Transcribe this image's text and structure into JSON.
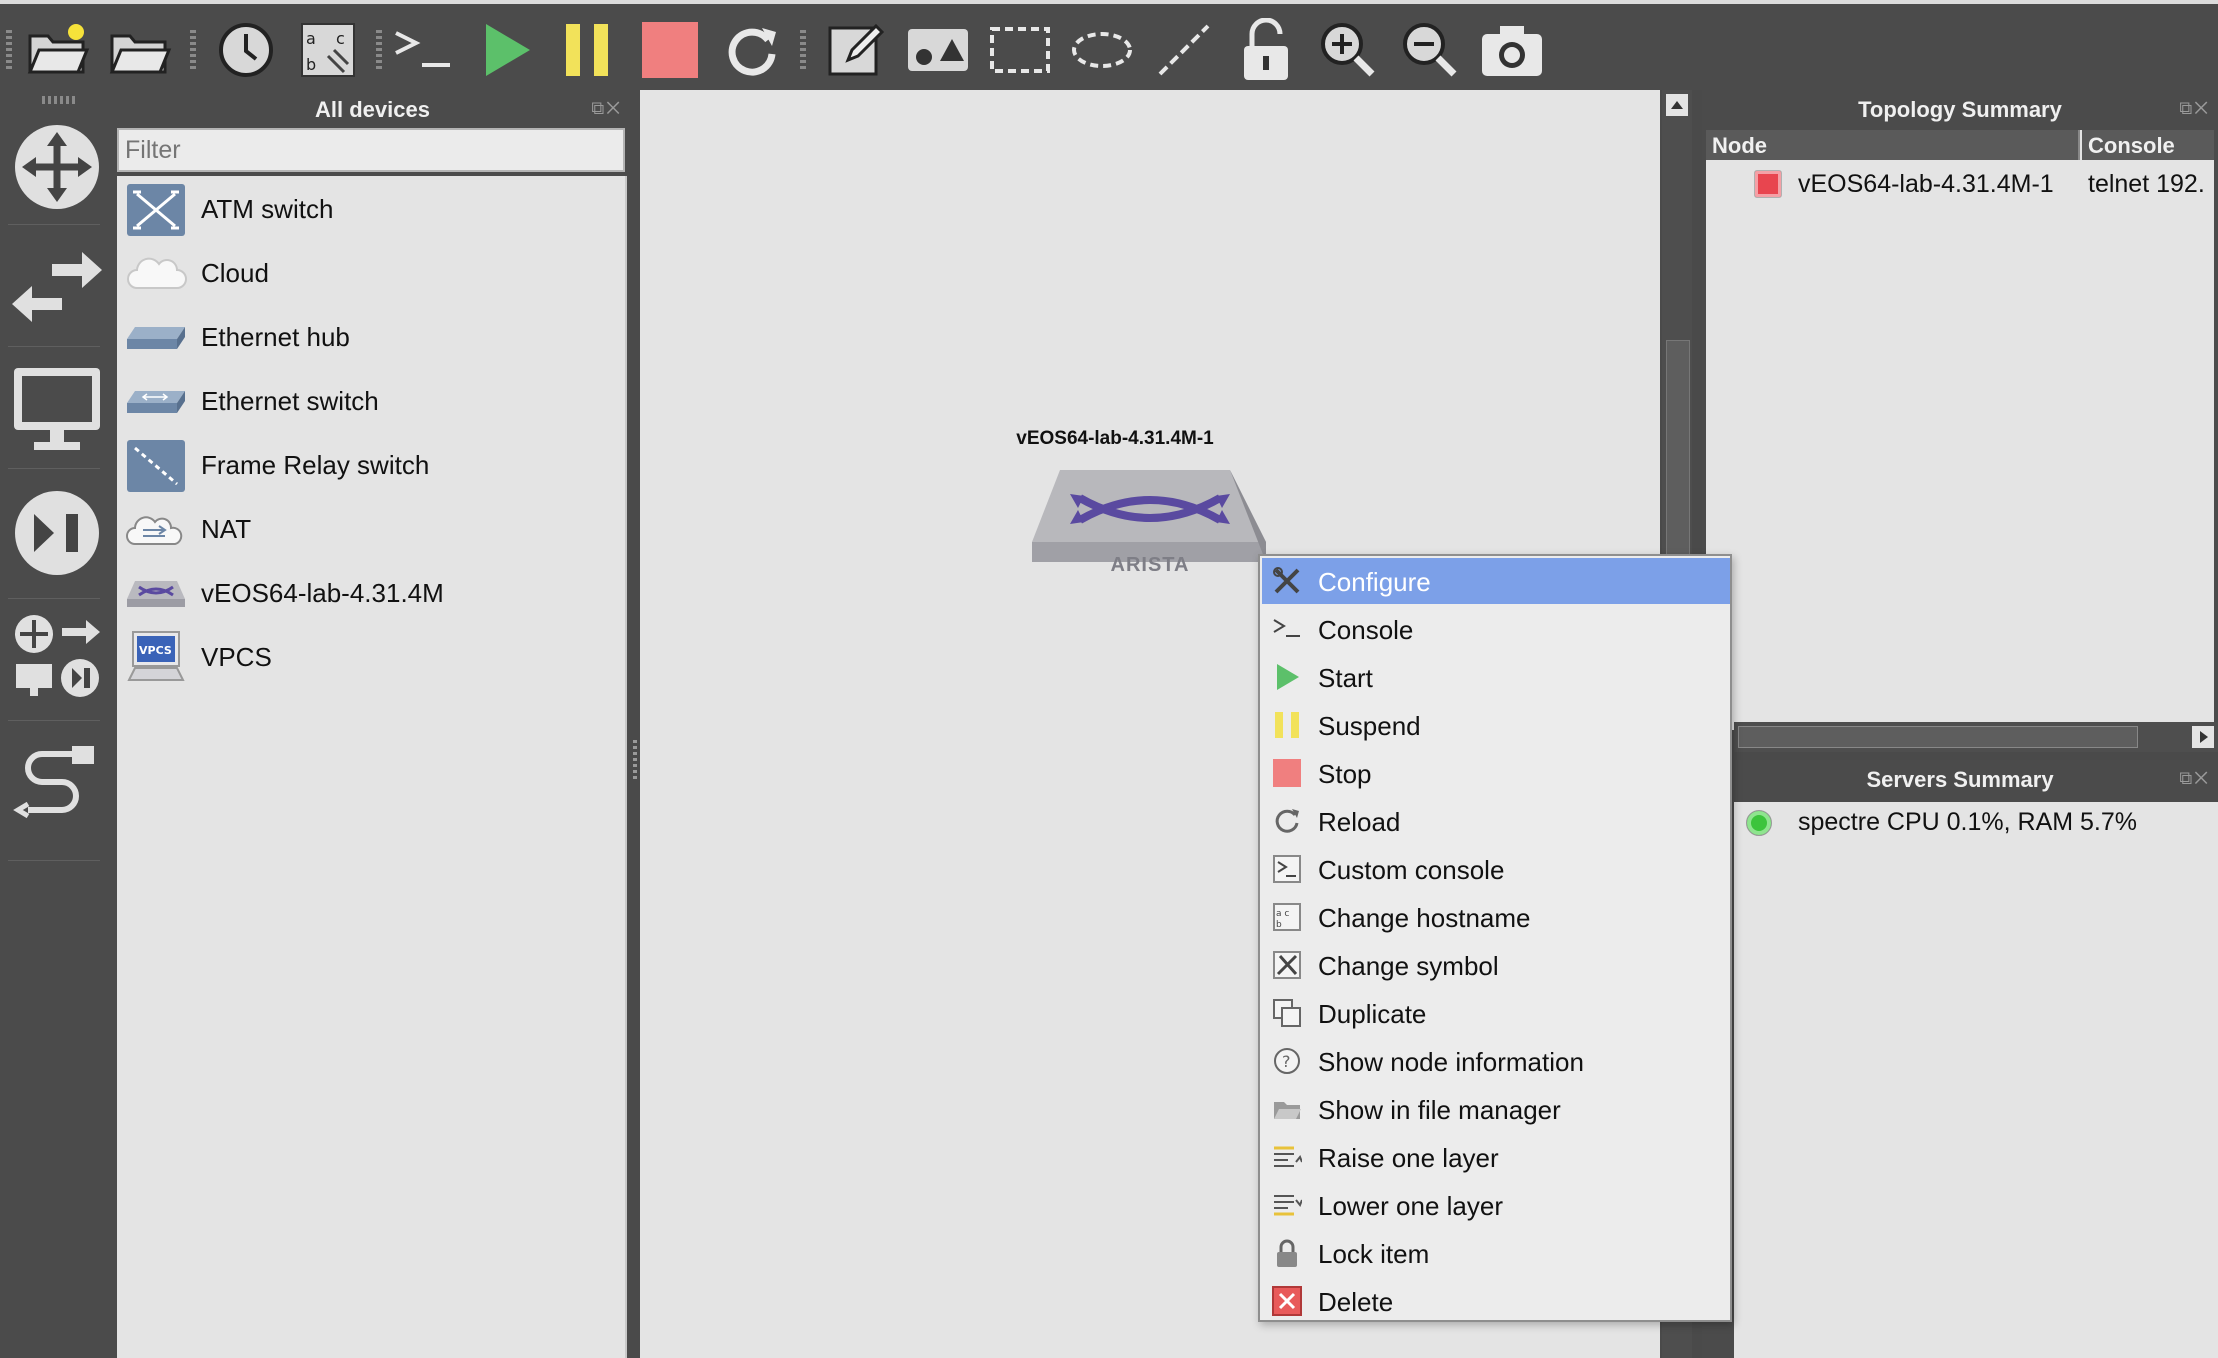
{
  "toolbar": {
    "buttons": [
      "new-project",
      "open-project",
      "snapshot",
      "show-interface-labels",
      "console-all",
      "start-all",
      "suspend-all",
      "stop-all",
      "reload-all",
      "add-note",
      "insert-picture",
      "draw-rectangle",
      "draw-ellipse",
      "draw-line",
      "lock-unlock",
      "zoom-in",
      "zoom-out",
      "screenshot"
    ]
  },
  "devices_panel": {
    "title": "All devices",
    "filter_placeholder": "Filter",
    "items": [
      {
        "label": "ATM switch",
        "icon": "atm-switch-icon"
      },
      {
        "label": "Cloud",
        "icon": "cloud-icon"
      },
      {
        "label": "Ethernet hub",
        "icon": "ethernet-hub-icon"
      },
      {
        "label": "Ethernet switch",
        "icon": "ethernet-switch-icon"
      },
      {
        "label": "Frame Relay switch",
        "icon": "frame-relay-switch-icon"
      },
      {
        "label": "NAT",
        "icon": "nat-icon"
      },
      {
        "label": "vEOS64-lab-4.31.4M",
        "icon": "arista-switch-icon"
      },
      {
        "label": "VPCS",
        "icon": "vpcs-icon"
      }
    ]
  },
  "canvas": {
    "node": {
      "label": "vEOS64-lab-4.31.4M-1",
      "brand": "ARISTA"
    }
  },
  "context_menu": {
    "items": [
      {
        "label": "Configure",
        "icon": "wrench-screwdriver-icon",
        "selected": true
      },
      {
        "label": "Console",
        "icon": "terminal-icon"
      },
      {
        "label": "Start",
        "icon": "play-icon"
      },
      {
        "label": "Suspend",
        "icon": "pause-icon"
      },
      {
        "label": "Stop",
        "icon": "stop-icon"
      },
      {
        "label": "Reload",
        "icon": "reload-icon"
      },
      {
        "label": "Custom console",
        "icon": "custom-console-icon"
      },
      {
        "label": "Change hostname",
        "icon": "hostname-icon"
      },
      {
        "label": "Change symbol",
        "icon": "symbol-icon"
      },
      {
        "label": "Duplicate",
        "icon": "duplicate-icon"
      },
      {
        "label": "Show node information",
        "icon": "info-icon"
      },
      {
        "label": "Show in file manager",
        "icon": "folder-icon"
      },
      {
        "label": "Raise one layer",
        "icon": "raise-layer-icon"
      },
      {
        "label": "Lower one layer",
        "icon": "lower-layer-icon"
      },
      {
        "label": "Lock item",
        "icon": "lock-icon"
      },
      {
        "label": "Delete",
        "icon": "delete-icon"
      }
    ]
  },
  "topology_summary": {
    "title": "Topology Summary",
    "columns": [
      "Node",
      "Console"
    ],
    "rows": [
      {
        "node": "vEOS64-lab-4.31.4M-1",
        "console": "telnet 192.",
        "status_color": "#e8454f"
      }
    ]
  },
  "servers_summary": {
    "title": "Servers Summary",
    "rows": [
      {
        "text": "spectre CPU 0.1%, RAM 5.7%",
        "status_color": "#3cc43c"
      }
    ]
  },
  "colors": {
    "accent_selected": "#7ca0e8",
    "start_green": "#5cc06a",
    "suspend_yellow": "#f2e25a",
    "stop_red": "#f07f7f"
  }
}
